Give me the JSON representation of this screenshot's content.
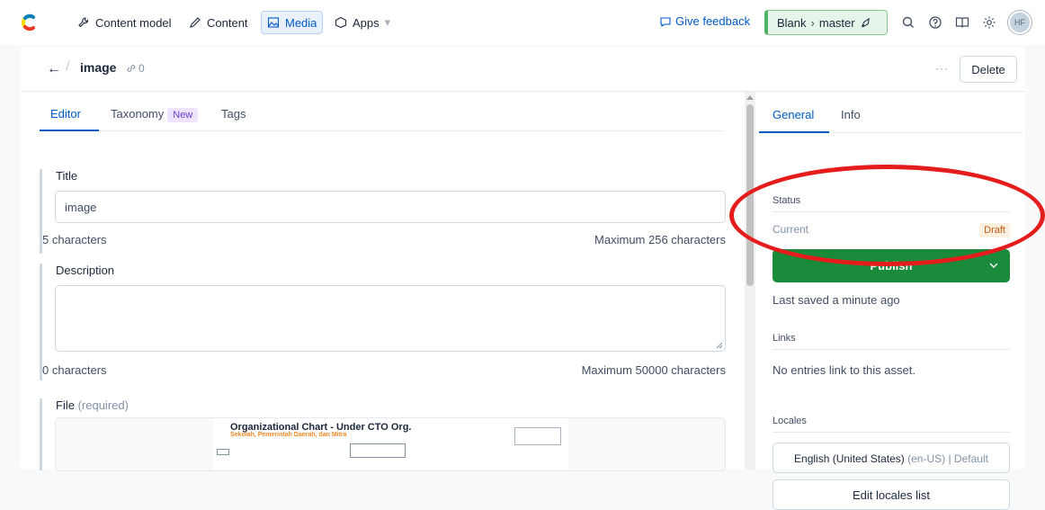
{
  "topbar": {
    "nav": [
      {
        "label": "Content model",
        "icon": "wrench-icon"
      },
      {
        "label": "Content",
        "icon": "pen-icon"
      },
      {
        "label": "Media",
        "icon": "image-icon"
      },
      {
        "label": "Apps",
        "icon": "apps-icon"
      }
    ],
    "feedback_label": "Give feedback",
    "env_space": "Blank",
    "env_branch": "master",
    "avatar_initials": "HF",
    "colors": {
      "accent": "#0059c8",
      "env_green": "#4bb361"
    }
  },
  "entry": {
    "title": "image",
    "link_count": "0",
    "more_label": "···",
    "delete_label": "Delete"
  },
  "tabs": {
    "editor": "Editor",
    "taxonomy": "Taxonomy",
    "taxonomy_badge": "New",
    "tags": "Tags"
  },
  "fields": {
    "title_label": "Title",
    "title_value": "image",
    "title_count": "5 characters",
    "title_max": "Maximum 256 characters",
    "description_label": "Description",
    "description_count": "0 characters",
    "description_max": "Maximum 50000 characters",
    "file_label": "File",
    "file_required": "(required)"
  },
  "file_preview": {
    "title": "Organizational Chart - Under CTO Org.",
    "subtitle": "Sekolah, Pemerintah Daerah, dan Mitra"
  },
  "sidebar": {
    "tab_general": "General",
    "tab_info": "Info",
    "status_heading": "Status",
    "current_label": "Current",
    "draft_badge": "Draft",
    "publish_label": "Publish",
    "saved_text": "Last saved a minute ago",
    "links_heading": "Links",
    "links_text": "No entries link to this asset.",
    "locales_heading": "Locales",
    "locale_name": "English (United States)",
    "locale_code": "(en-US)",
    "locale_default": "| Default",
    "edit_locales_label": "Edit locales list",
    "publish_color": "#1a8a3b"
  },
  "annotation": {
    "color": "#e41c1c",
    "shape": "ellipse"
  }
}
